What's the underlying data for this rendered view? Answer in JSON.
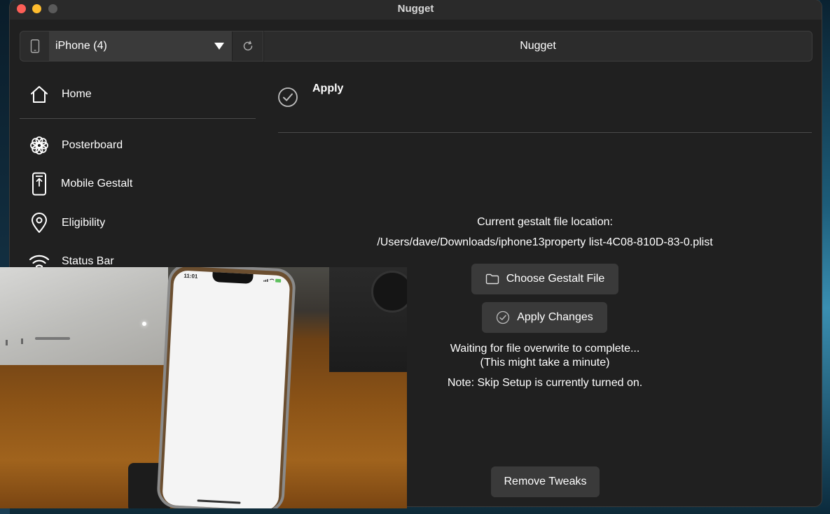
{
  "window": {
    "title": "Nugget"
  },
  "toolbar": {
    "device_label": "iPhone (4)",
    "app_title": "Nugget"
  },
  "sidebar": {
    "items": [
      {
        "label": "Home",
        "icon": "house-icon"
      },
      {
        "label": "Posterboard",
        "icon": "flower-icon"
      },
      {
        "label": "Mobile Gestalt",
        "icon": "phone-upload-icon"
      },
      {
        "label": "Eligibility",
        "icon": "location-pin-icon"
      },
      {
        "label": "Status Bar",
        "icon": "wifi-icon"
      }
    ]
  },
  "main": {
    "header_label": "Apply",
    "gestalt_location_label": "Current gestalt file location:",
    "gestalt_path": "/Users/dave/Downloads/iphone13property list-4C08-810D-83-0.plist",
    "choose_button_label": "Choose Gestalt File",
    "apply_button_label": "Apply Changes",
    "status_line_1": "Waiting for file overwrite to complete...",
    "status_line_2": "(This might take a minute)",
    "note": "Note: Skip Setup is currently turned on.",
    "remove_button_label": "Remove Tweaks"
  },
  "video_overlay": {
    "phone_time": "11:01"
  },
  "colors": {
    "window_bg": "#202020",
    "button_bg": "#3a3a3a",
    "close": "#fe5f57",
    "minimize": "#febc2e"
  }
}
